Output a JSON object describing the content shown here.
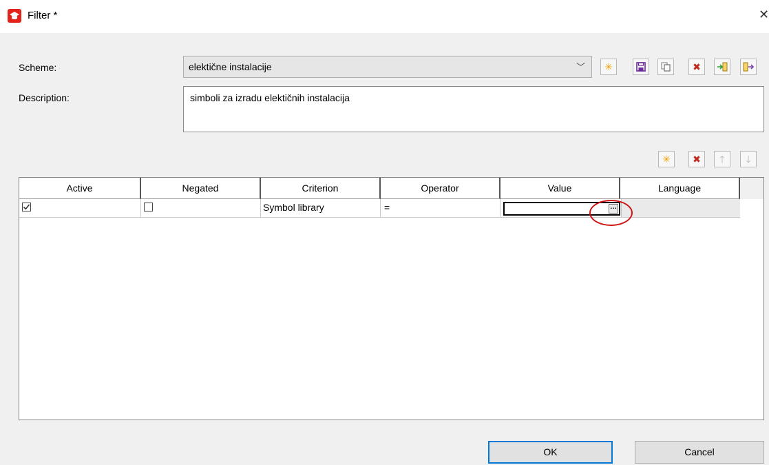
{
  "window": {
    "title": "Filter *",
    "close_icon": "close-icon"
  },
  "scheme": {
    "label": "Scheme:",
    "value": "elektične instalacije"
  },
  "description": {
    "label": "Description:",
    "value": "simboli za izradu elektičnih instalacija"
  },
  "scheme_toolbar": [
    {
      "name": "new-scheme-button",
      "icon": "sun-icon",
      "glyph": "✳"
    },
    {
      "name": "save-scheme-button",
      "icon": "save-icon",
      "glyph": "💾"
    },
    {
      "name": "copy-scheme-button",
      "icon": "copy-icon",
      "glyph": "⧉"
    },
    {
      "name": "delete-scheme-button",
      "icon": "delete-icon",
      "glyph": "✖"
    },
    {
      "name": "import-scheme-button",
      "icon": "import-icon",
      "glyph": "⇥"
    },
    {
      "name": "export-scheme-button",
      "icon": "export-icon",
      "glyph": "⇤"
    }
  ],
  "row_toolbar": [
    {
      "name": "add-row-button",
      "icon": "sun-icon",
      "glyph": "✳",
      "enabled": true
    },
    {
      "name": "delete-row-button",
      "icon": "delete-icon",
      "glyph": "✖",
      "enabled": true
    },
    {
      "name": "move-up-button",
      "icon": "arrow-up-icon",
      "glyph": "↑",
      "enabled": false
    },
    {
      "name": "move-down-button",
      "icon": "arrow-down-icon",
      "glyph": "↓",
      "enabled": false
    }
  ],
  "grid": {
    "columns": [
      "Active",
      "Negated",
      "Criterion",
      "Operator",
      "Value",
      "Language"
    ],
    "rows": [
      {
        "active": true,
        "negated": false,
        "criterion": "Symbol library",
        "operator": "=",
        "value": "",
        "language": ""
      }
    ]
  },
  "buttons": {
    "ok": "OK",
    "cancel": "Cancel"
  },
  "colors": {
    "accent": "#0078d7",
    "highlight_ring": "#d01313",
    "app_icon": "#e2231a",
    "delete_icon": "#c0281e",
    "sun_icon": "#f2a000"
  }
}
